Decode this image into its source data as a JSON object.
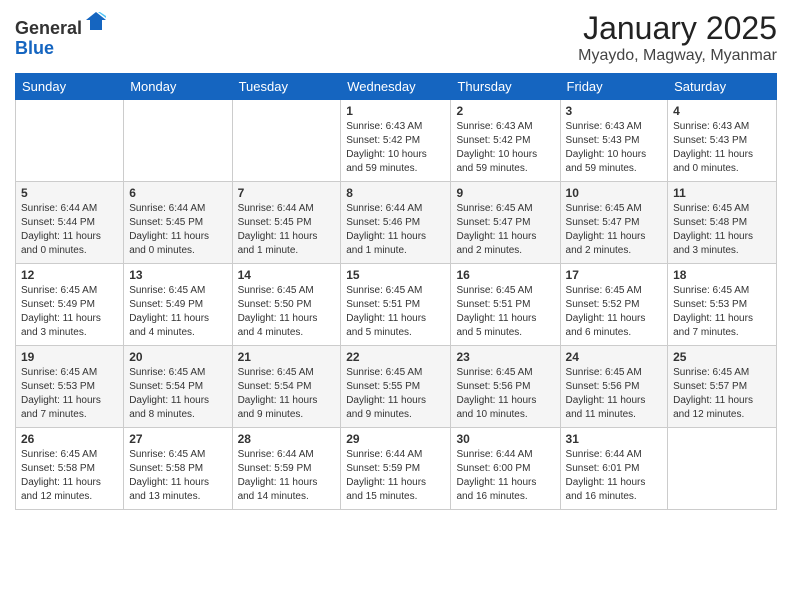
{
  "header": {
    "logo_general": "General",
    "logo_blue": "Blue",
    "title": "January 2025",
    "subtitle": "Myaydo, Magway, Myanmar"
  },
  "days": [
    "Sunday",
    "Monday",
    "Tuesday",
    "Wednesday",
    "Thursday",
    "Friday",
    "Saturday"
  ],
  "weeks": [
    [
      {
        "date": "",
        "info": ""
      },
      {
        "date": "",
        "info": ""
      },
      {
        "date": "",
        "info": ""
      },
      {
        "date": "1",
        "info": "Sunrise: 6:43 AM\nSunset: 5:42 PM\nDaylight: 10 hours and 59 minutes."
      },
      {
        "date": "2",
        "info": "Sunrise: 6:43 AM\nSunset: 5:42 PM\nDaylight: 10 hours and 59 minutes."
      },
      {
        "date": "3",
        "info": "Sunrise: 6:43 AM\nSunset: 5:43 PM\nDaylight: 10 hours and 59 minutes."
      },
      {
        "date": "4",
        "info": "Sunrise: 6:43 AM\nSunset: 5:43 PM\nDaylight: 11 hours and 0 minutes."
      }
    ],
    [
      {
        "date": "5",
        "info": "Sunrise: 6:44 AM\nSunset: 5:44 PM\nDaylight: 11 hours and 0 minutes."
      },
      {
        "date": "6",
        "info": "Sunrise: 6:44 AM\nSunset: 5:45 PM\nDaylight: 11 hours and 0 minutes."
      },
      {
        "date": "7",
        "info": "Sunrise: 6:44 AM\nSunset: 5:45 PM\nDaylight: 11 hours and 1 minute."
      },
      {
        "date": "8",
        "info": "Sunrise: 6:44 AM\nSunset: 5:46 PM\nDaylight: 11 hours and 1 minute."
      },
      {
        "date": "9",
        "info": "Sunrise: 6:45 AM\nSunset: 5:47 PM\nDaylight: 11 hours and 2 minutes."
      },
      {
        "date": "10",
        "info": "Sunrise: 6:45 AM\nSunset: 5:47 PM\nDaylight: 11 hours and 2 minutes."
      },
      {
        "date": "11",
        "info": "Sunrise: 6:45 AM\nSunset: 5:48 PM\nDaylight: 11 hours and 3 minutes."
      }
    ],
    [
      {
        "date": "12",
        "info": "Sunrise: 6:45 AM\nSunset: 5:49 PM\nDaylight: 11 hours and 3 minutes."
      },
      {
        "date": "13",
        "info": "Sunrise: 6:45 AM\nSunset: 5:49 PM\nDaylight: 11 hours and 4 minutes."
      },
      {
        "date": "14",
        "info": "Sunrise: 6:45 AM\nSunset: 5:50 PM\nDaylight: 11 hours and 4 minutes."
      },
      {
        "date": "15",
        "info": "Sunrise: 6:45 AM\nSunset: 5:51 PM\nDaylight: 11 hours and 5 minutes."
      },
      {
        "date": "16",
        "info": "Sunrise: 6:45 AM\nSunset: 5:51 PM\nDaylight: 11 hours and 5 minutes."
      },
      {
        "date": "17",
        "info": "Sunrise: 6:45 AM\nSunset: 5:52 PM\nDaylight: 11 hours and 6 minutes."
      },
      {
        "date": "18",
        "info": "Sunrise: 6:45 AM\nSunset: 5:53 PM\nDaylight: 11 hours and 7 minutes."
      }
    ],
    [
      {
        "date": "19",
        "info": "Sunrise: 6:45 AM\nSunset: 5:53 PM\nDaylight: 11 hours and 7 minutes."
      },
      {
        "date": "20",
        "info": "Sunrise: 6:45 AM\nSunset: 5:54 PM\nDaylight: 11 hours and 8 minutes."
      },
      {
        "date": "21",
        "info": "Sunrise: 6:45 AM\nSunset: 5:54 PM\nDaylight: 11 hours and 9 minutes."
      },
      {
        "date": "22",
        "info": "Sunrise: 6:45 AM\nSunset: 5:55 PM\nDaylight: 11 hours and 9 minutes."
      },
      {
        "date": "23",
        "info": "Sunrise: 6:45 AM\nSunset: 5:56 PM\nDaylight: 11 hours and 10 minutes."
      },
      {
        "date": "24",
        "info": "Sunrise: 6:45 AM\nSunset: 5:56 PM\nDaylight: 11 hours and 11 minutes."
      },
      {
        "date": "25",
        "info": "Sunrise: 6:45 AM\nSunset: 5:57 PM\nDaylight: 11 hours and 12 minutes."
      }
    ],
    [
      {
        "date": "26",
        "info": "Sunrise: 6:45 AM\nSunset: 5:58 PM\nDaylight: 11 hours and 12 minutes."
      },
      {
        "date": "27",
        "info": "Sunrise: 6:45 AM\nSunset: 5:58 PM\nDaylight: 11 hours and 13 minutes."
      },
      {
        "date": "28",
        "info": "Sunrise: 6:44 AM\nSunset: 5:59 PM\nDaylight: 11 hours and 14 minutes."
      },
      {
        "date": "29",
        "info": "Sunrise: 6:44 AM\nSunset: 5:59 PM\nDaylight: 11 hours and 15 minutes."
      },
      {
        "date": "30",
        "info": "Sunrise: 6:44 AM\nSunset: 6:00 PM\nDaylight: 11 hours and 16 minutes."
      },
      {
        "date": "31",
        "info": "Sunrise: 6:44 AM\nSunset: 6:01 PM\nDaylight: 11 hours and 16 minutes."
      },
      {
        "date": "",
        "info": ""
      }
    ]
  ]
}
